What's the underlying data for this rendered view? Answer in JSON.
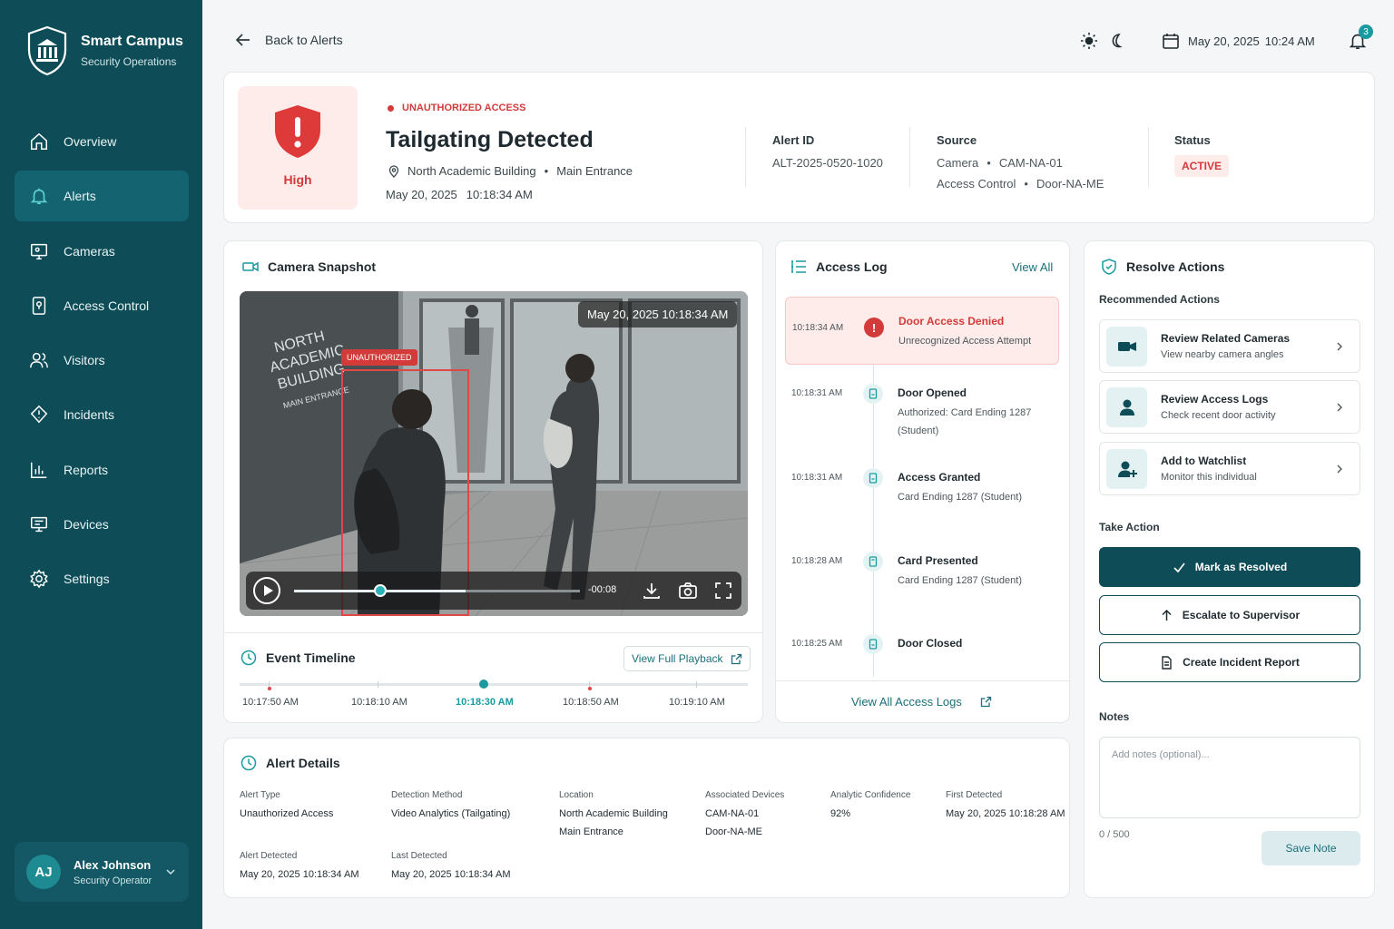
{
  "brand": {
    "title": "Smart Campus",
    "subtitle": "Security Operations"
  },
  "nav": [
    {
      "label": "Overview",
      "icon": "home-icon"
    },
    {
      "label": "Alerts",
      "icon": "bell-icon",
      "active": true
    },
    {
      "label": "Cameras",
      "icon": "monitor-icon"
    },
    {
      "label": "Access Control",
      "icon": "keypad-icon"
    },
    {
      "label": "Visitors",
      "icon": "users-icon"
    },
    {
      "label": "Incidents",
      "icon": "alert-shield-icon"
    },
    {
      "label": "Reports",
      "icon": "chart-icon"
    },
    {
      "label": "Devices",
      "icon": "devices-icon"
    },
    {
      "label": "Settings",
      "icon": "gear-icon"
    }
  ],
  "user": {
    "initials": "AJ",
    "name": "Alex Johnson",
    "role": "Security Operator"
  },
  "topbar": {
    "back_label": "Back to Alerts",
    "date": "May 20, 2025",
    "time": "10:24 AM",
    "notifications": "3"
  },
  "alert": {
    "severity": "High",
    "type": "UNAUTHORIZED ACCESS",
    "title": "Tailgating Detected",
    "building": "North Academic Building",
    "entrance": "Main Entrance",
    "date": "May 20, 2025",
    "time": "10:18:34 AM",
    "id_label": "Alert ID",
    "id": "ALT-2025-0520-1020",
    "source_label": "Source",
    "source_line1_a": "Camera",
    "source_line1_b": "CAM-NA-01",
    "source_line2_a": "Access Control",
    "source_line2_b": "Door-NA-ME",
    "status_label": "Status",
    "status": "ACTIVE"
  },
  "camera": {
    "title": "Camera Snapshot",
    "stamp": "May 20, 2025   10:18:34 AM",
    "tag": "UNAUTHORIZED",
    "sign_lines": [
      "NORTH",
      "ACADEMIC",
      "BUILDING",
      "MAIN ENTRANCE"
    ],
    "remaining": "-00:08",
    "progress": 0.3
  },
  "timeline": {
    "title": "Event Timeline",
    "button": "View Full Playback",
    "labels": [
      "10:17:50 AM",
      "10:18:10 AM",
      "10:18:30 AM",
      "10:18:50 AM",
      "10:19:10 AM"
    ],
    "active_index": 2
  },
  "access_log": {
    "title": "Access Log",
    "view_all": "View All",
    "footer": "View All Access Logs",
    "entries": [
      {
        "time": "10:18:34 AM",
        "title": "Door Access Denied",
        "sub": "Unrecognized Access Attempt",
        "status": "denied"
      },
      {
        "time": "10:18:31 AM",
        "title": "Door Opened",
        "sub": "Authorized: Card Ending 1287 (Student)"
      },
      {
        "time": "10:18:31 AM",
        "title": "Access Granted",
        "sub": "Card Ending 1287 (Student)"
      },
      {
        "time": "10:18:28 AM",
        "title": "Card Presented",
        "sub": "Card Ending 1287 (Student)"
      },
      {
        "time": "10:18:25 AM",
        "title": "Door Closed",
        "sub": ""
      }
    ]
  },
  "resolve": {
    "title": "Resolve Actions",
    "recommended_label": "Recommended Actions",
    "recommended": [
      {
        "title": "Review Related Cameras",
        "sub": "View nearby camera angles",
        "icon": "video-camera-icon"
      },
      {
        "title": "Review Access Logs",
        "sub": "Check recent door activity",
        "icon": "person-icon"
      },
      {
        "title": "Add to Watchlist",
        "sub": "Monitor this individual",
        "icon": "person-add-icon"
      }
    ],
    "take_action_label": "Take Action",
    "resolve_button": "Mark as Resolved",
    "escalate_button": "Escalate to Supervisor",
    "report_button": "Create Incident Report",
    "notes_label": "Notes",
    "notes_placeholder": "Add notes (optional)...",
    "counter": "0 / 500",
    "save_button": "Save Note"
  },
  "details": {
    "title": "Alert Details",
    "alert_type_label": "Alert Type",
    "alert_type": "Unauthorized Access",
    "method_label": "Detection Method",
    "method": "Video Analytics (Tailgating)",
    "location_label": "Location",
    "location_1": "North Academic Building",
    "location_2": "Main Entrance",
    "devices_label": "Associated Devices",
    "device_1": "CAM-NA-01",
    "device_2": "Door-NA-ME",
    "confidence_label": "Analytic Confidence",
    "confidence": "92%",
    "first_label": "First Detected",
    "first": "May 20, 2025  10:18:28 AM",
    "alert_detected_label": "Alert Detected",
    "alert_detected": "May 20, 2025  10:18:34 AM",
    "last_label": "Last Detected",
    "last": "May 20, 2025  10:18:34 AM"
  },
  "colors": {
    "sidebar": "#0e4d58",
    "accent": "#1a9aa0",
    "danger": "#d33a3a"
  }
}
